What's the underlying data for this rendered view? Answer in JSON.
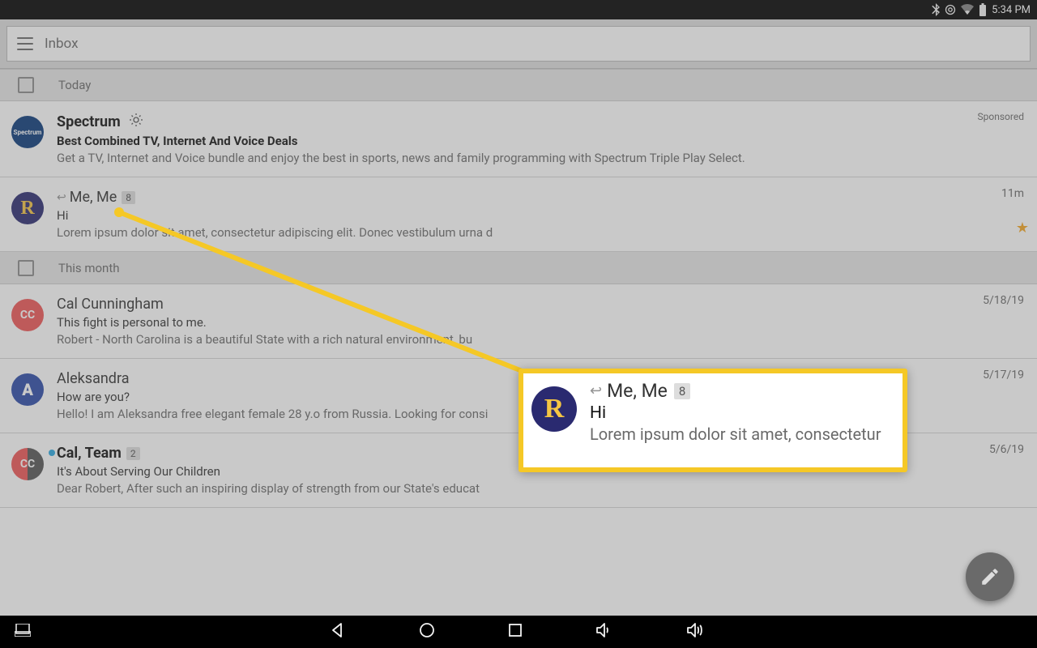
{
  "status_bar": {
    "time": "5:34 PM"
  },
  "toolbar": {
    "title": "Inbox"
  },
  "sections": {
    "today": "Today",
    "this_month": "This month"
  },
  "emails": {
    "spectrum": {
      "sender": "Spectrum",
      "subject": "Best Combined TV, Internet And Voice Deals",
      "snippet": "Get a TV, Internet and Voice bundle and enjoy the best in sports, news and family programming with Spectrum Triple Play Select.",
      "meta": "Sponsored",
      "avatar_text": "Spectrum"
    },
    "me": {
      "sender": "Me, Me",
      "count": "8",
      "subject": "Hi",
      "snippet": "Lorem ipsum dolor sit amet, consectetur adipiscing elit. Donec vestibulum urna d",
      "meta": "11m"
    },
    "cal": {
      "sender": "Cal Cunningham",
      "subject": "This fight is personal to me.",
      "snippet": "Robert - North Carolina is a beautiful State with a rich natural environment, bu",
      "meta": "5/18/19",
      "avatar_text": "CC"
    },
    "alek": {
      "sender": "Aleksandra",
      "subject": "How are you?",
      "snippet": "Hello! I am Aleksandra free elegant female 28 y.o from Russia. Looking for consi",
      "meta": "5/17/19"
    },
    "team": {
      "sender": "Cal, Team",
      "count": "2",
      "subject": "It's About Serving Our Children",
      "snippet": "Dear Robert, After such an inspiring display of strength from our State's educat",
      "meta": "5/6/19",
      "avatar_text": "CC"
    }
  },
  "zoom": {
    "sender": "Me, Me",
    "count": "8",
    "subject": "Hi",
    "snippet": "Lorem ipsum dolor sit amet, consectetur"
  }
}
